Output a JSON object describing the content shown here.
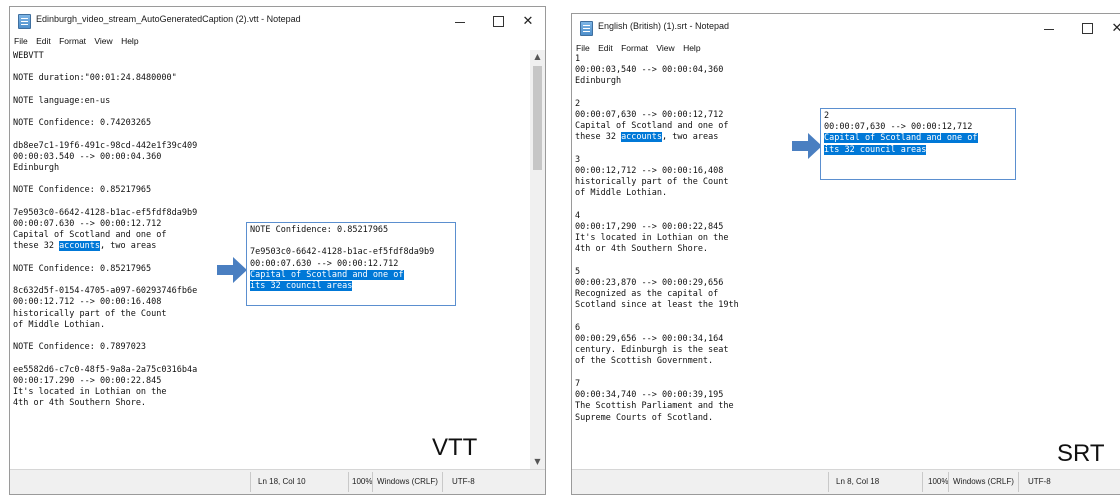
{
  "left_window": {
    "title": "Edinburgh_video_stream_AutoGeneratedCaption (2).vtt - Notepad",
    "menu": [
      "File",
      "Edit",
      "Format",
      "View",
      "Help"
    ],
    "lines": [
      "WEBVTT",
      "",
      "NOTE duration:\"00:01:24.8480000\"",
      "",
      "NOTE language:en-us",
      "",
      "NOTE Confidence: 0.74203265",
      "",
      "db8ee7c1-19f6-491c-98cd-442e1f39c409",
      "00:00:03.540 --> 00:00:04.360",
      "Edinburgh",
      "",
      "NOTE Confidence: 0.85217965",
      "",
      "7e9503c0-6642-4128-b1ac-ef5fdf8da9b9",
      "00:00:07.630 --> 00:00:12.712",
      "Capital of Scotland and one of",
      "these 32 ",
      "",
      "NOTE Confidence: 0.85217965",
      "",
      "8c632d5f-0154-4705-a097-60293746fb6e",
      "00:00:12.712 --> 00:00:16.408",
      "historically part of the Count",
      "of Middle Lothian.",
      "",
      "NOTE Confidence: 0.7897023",
      "",
      "ee5582d6-c7c0-48f5-9a8a-2a75c0316b4a",
      "00:00:17.290 --> 00:00:22.845",
      "It's located in Lothian on the",
      "4th or 4th Southern Shore."
    ],
    "highlight_word": "accounts",
    "highlight_rest": ", two areas",
    "status": {
      "position": "Ln 18, Col 10",
      "zoom": "100%",
      "eol": "Windows (CRLF)",
      "encoding": "UTF-8"
    },
    "callout": {
      "line1": "NOTE Confidence: 0.85217965",
      "line2": "",
      "line3": "7e9503c0-6642-4128-b1ac-ef5fdf8da9b9",
      "line4": "00:00:07.630 --> 00:00:12.712",
      "hl1": "Capital of Scotland and one of",
      "hl2": "its 32 council areas"
    },
    "label": "VTT"
  },
  "right_window": {
    "title": "English (British) (1).srt - Notepad",
    "menu": [
      "File",
      "Edit",
      "Format",
      "View",
      "Help"
    ],
    "lines": [
      "1",
      "00:00:03,540 --> 00:00:04,360",
      "Edinburgh",
      "",
      "2",
      "00:00:07,630 --> 00:00:12,712",
      "Capital of Scotland and one of",
      "these 32 ",
      "",
      "3",
      "00:00:12,712 --> 00:00:16,408",
      "historically part of the Count",
      "of Middle Lothian.",
      "",
      "4",
      "00:00:17,290 --> 00:00:22,845",
      "It's located in Lothian on the",
      "4th or 4th Southern Shore.",
      "",
      "5",
      "00:00:23,870 --> 00:00:29,656",
      "Recognized as the capital of",
      "Scotland since at least the 19th",
      "",
      "6",
      "00:00:29,656 --> 00:00:34,164",
      "century. Edinburgh is the seat",
      "of the Scottish Government.",
      "",
      "7",
      "00:00:34,740 --> 00:00:39,195",
      "The Scottish Parliament and the",
      "Supreme Courts of Scotland."
    ],
    "highlight_word": "accounts",
    "highlight_rest": ", two areas",
    "status": {
      "position": "Ln 8, Col 18",
      "zoom": "100%",
      "eol": "Windows (CRLF)",
      "encoding": "UTF-8"
    },
    "callout": {
      "line1": "2",
      "line2": "00:00:07,630 --> 00:00:12,712",
      "hl1": "Capital of Scotland and one of",
      "hl2": "its 32 council areas"
    },
    "label": "SRT"
  },
  "controls": {
    "minimize": "—",
    "maximize": "",
    "close": "✕"
  },
  "accent_color": "#0078d7",
  "callout_border_color": "#5b8fcf",
  "arrow_color": "#4a7fc1"
}
